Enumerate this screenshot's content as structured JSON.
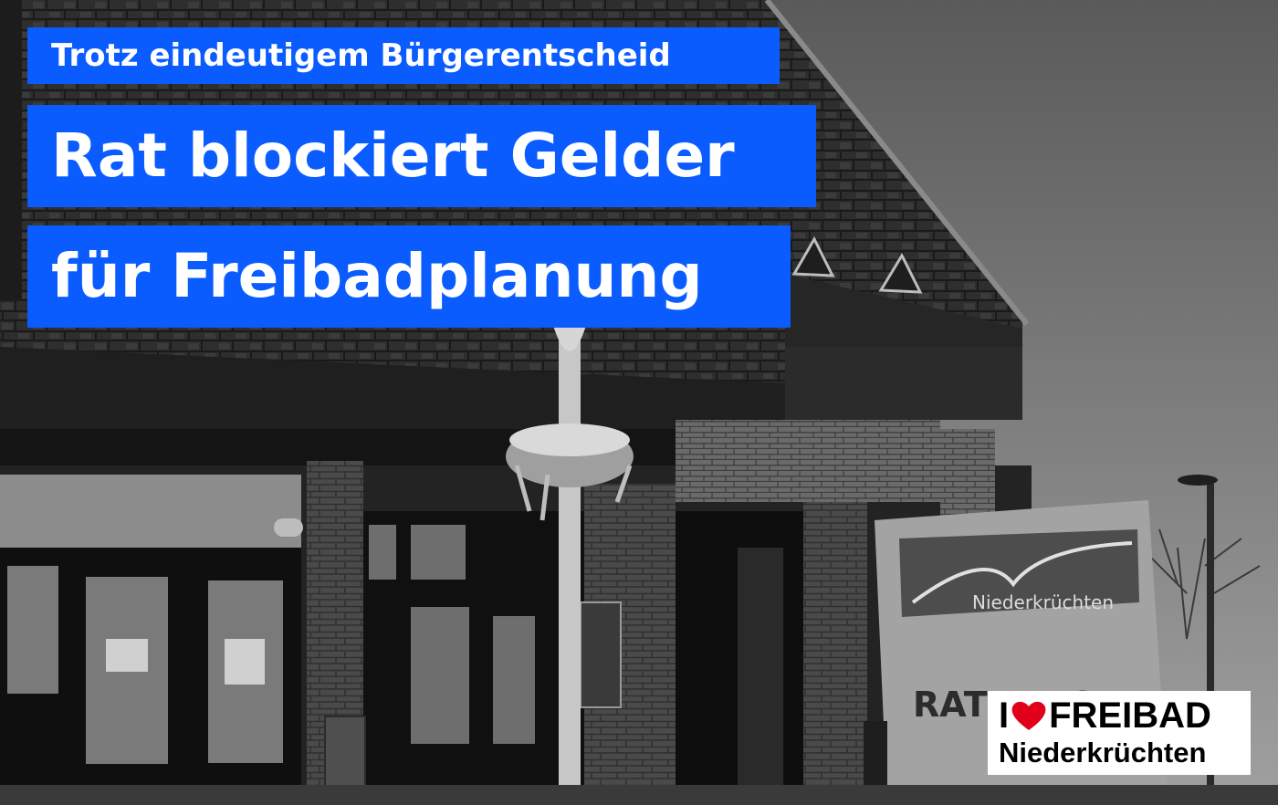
{
  "headline": {
    "kicker": "Trotz eindeutigem Bürgerentscheid",
    "line1": "Rat blockiert Gelder",
    "line2": "für Freibadplanung"
  },
  "sign": {
    "logo_text": "Niederkrüchten",
    "building_text": "RATHAUS"
  },
  "badge": {
    "prefix": "I",
    "heart_icon": "heart-icon",
    "word": "FREIBAD",
    "place": "Niederkrüchten"
  },
  "colors": {
    "headline_bg": "#0a5cff",
    "headline_text": "#ffffff",
    "heart": "#e0001b"
  }
}
